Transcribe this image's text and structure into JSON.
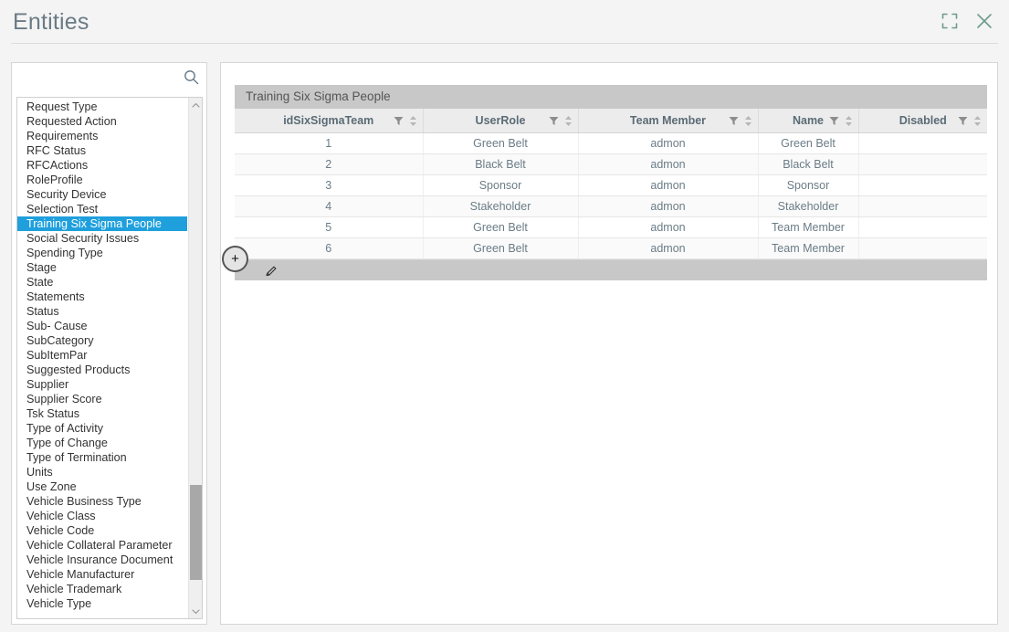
{
  "window": {
    "title": "Entities",
    "actions": [
      {
        "name": "expand-icon",
        "label": "Maximize"
      },
      {
        "name": "close-icon",
        "label": "Close"
      }
    ],
    "accent_color": "#1fa0dd",
    "title_color": "#6a7b85",
    "icon_color": "#6d9c8a"
  },
  "search": {
    "value": "",
    "placeholder": "",
    "icon": "search-icon"
  },
  "sidebar": {
    "selected": "Training Six Sigma People",
    "scrollbar": {
      "up_icon": "chevron-up-icon",
      "down_icon": "chevron-down-icon"
    },
    "items": [
      {
        "label": "Request Type"
      },
      {
        "label": "Requested Action"
      },
      {
        "label": "Requirements"
      },
      {
        "label": "RFC Status"
      },
      {
        "label": "RFCActions"
      },
      {
        "label": "RoleProfile"
      },
      {
        "label": "Security Device"
      },
      {
        "label": "Selection Test"
      },
      {
        "label": "Training Six Sigma People"
      },
      {
        "label": "Social Security Issues"
      },
      {
        "label": "Spending Type"
      },
      {
        "label": "Stage"
      },
      {
        "label": "State"
      },
      {
        "label": "Statements"
      },
      {
        "label": "Status"
      },
      {
        "label": "Sub- Cause"
      },
      {
        "label": "SubCategory"
      },
      {
        "label": "SubItemPar"
      },
      {
        "label": "Suggested Products"
      },
      {
        "label": "Supplier"
      },
      {
        "label": "Supplier Score"
      },
      {
        "label": "Tsk Status"
      },
      {
        "label": "Type of Activity"
      },
      {
        "label": "Type of Change"
      },
      {
        "label": "Type of Termination"
      },
      {
        "label": "Units"
      },
      {
        "label": "Use Zone"
      },
      {
        "label": "Vehicle Business Type"
      },
      {
        "label": "Vehicle Class"
      },
      {
        "label": "Vehicle Code"
      },
      {
        "label": "Vehicle Collateral Parameter"
      },
      {
        "label": "Vehicle Insurance Document"
      },
      {
        "label": "Vehicle Manufacturer"
      },
      {
        "label": "Vehicle Trademark"
      },
      {
        "label": "Vehicle Type"
      }
    ]
  },
  "grid": {
    "caption": "Training Six Sigma People",
    "columns": [
      {
        "label": "idSixSigmaTeam",
        "filter_icon": "filter-icon",
        "sort_icon": "sort-icon"
      },
      {
        "label": "UserRole",
        "filter_icon": "filter-icon",
        "sort_icon": "sort-icon"
      },
      {
        "label": "Team Member",
        "filter_icon": "filter-icon",
        "sort_icon": "sort-icon"
      },
      {
        "label": "Name",
        "filter_icon": "filter-icon",
        "sort_icon": "sort-icon"
      },
      {
        "label": "Disabled",
        "filter_icon": "filter-icon",
        "sort_icon": "sort-icon"
      }
    ],
    "rows": [
      {
        "idSixSigmaTeam": "1",
        "UserRole": "Green Belt",
        "TeamMember": "admon",
        "Name": "Green Belt",
        "Disabled": ""
      },
      {
        "idSixSigmaTeam": "2",
        "UserRole": "Black Belt",
        "TeamMember": "admon",
        "Name": "Black Belt",
        "Disabled": ""
      },
      {
        "idSixSigmaTeam": "3",
        "UserRole": "Sponsor",
        "TeamMember": "admon",
        "Name": "Sponsor",
        "Disabled": ""
      },
      {
        "idSixSigmaTeam": "4",
        "UserRole": "Stakeholder",
        "TeamMember": "admon",
        "Name": "Stakeholder",
        "Disabled": ""
      },
      {
        "idSixSigmaTeam": "5",
        "UserRole": "Green Belt",
        "TeamMember": "admon",
        "Name": "Team Member",
        "Disabled": ""
      },
      {
        "idSixSigmaTeam": "6",
        "UserRole": "Green Belt",
        "TeamMember": "admon",
        "Name": "Team Member",
        "Disabled": ""
      }
    ],
    "footer": {
      "add_label": "+",
      "add_icon": "plus-icon",
      "edit_icon": "pencil-icon"
    }
  }
}
